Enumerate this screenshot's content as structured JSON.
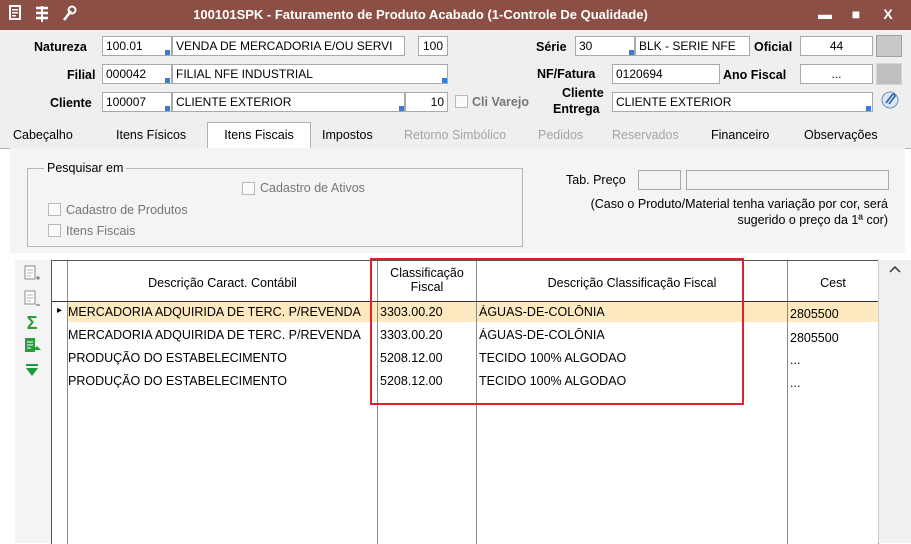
{
  "window": {
    "title": "100101SPK - Faturamento de Produto Acabado (1-Controle De Qualidade)",
    "titlebar_color": "#8c4f45",
    "buttons": {
      "minimize": "▬",
      "maximize": "■",
      "close": "X"
    }
  },
  "form": {
    "natureza": {
      "label": "Natureza",
      "code": "100.01",
      "desc": "VENDA DE MERCADORIA E/OU SERVI",
      "num": "100"
    },
    "filial": {
      "label": "Filial",
      "code": "000042",
      "desc": "FILIAL NFE INDUSTRIAL"
    },
    "cliente": {
      "label": "Cliente",
      "code": "100007",
      "desc": "CLIENTE EXTERIOR",
      "num": "10",
      "varejo_label": "Cli Varejo"
    },
    "serie": {
      "label": "Série",
      "code": "30",
      "desc": "BLK - SERIE NFE"
    },
    "oficial": {
      "label": "Oficial",
      "value": "44"
    },
    "nf_fatura": {
      "label": "NF/Fatura",
      "value": "0120694"
    },
    "ano_fiscal": {
      "label": "Ano Fiscal",
      "value": "..."
    },
    "cliente_entrega": {
      "label_line1": "Cliente",
      "label_line2": "Entrega",
      "value": "CLIENTE EXTERIOR"
    }
  },
  "tabs": [
    {
      "label": "Cabeçalho",
      "state": "normal"
    },
    {
      "label": "Itens Físicos",
      "state": "normal"
    },
    {
      "label": "Itens Fiscais",
      "state": "active"
    },
    {
      "label": "Impostos",
      "state": "normal"
    },
    {
      "label": "Retorno Simbólico",
      "state": "disabled"
    },
    {
      "label": "Pedidos",
      "state": "disabled"
    },
    {
      "label": "Reservados",
      "state": "disabled"
    },
    {
      "label": "Financeiro",
      "state": "normal"
    },
    {
      "label": "Observações",
      "state": "normal"
    }
  ],
  "search": {
    "group_title": "Pesquisar em",
    "cadastro_ativos": "Cadastro de Ativos",
    "cadastro_produtos": "Cadastro de Produtos",
    "itens_fiscais": "Itens Fiscais",
    "tab_preco_label": "Tab. Preço",
    "note_line1": "(Caso o Produto/Material tenha variação por cor, será",
    "note_line2": "sugerido o preço da 1ª cor)"
  },
  "table": {
    "headers": {
      "descricao": "Descrição Caract. Contábil",
      "classificacao_l1": "Classificação",
      "classificacao_l2": "Fiscal",
      "descricao_class": "Descrição Classificação Fiscal",
      "cest": "Cest"
    },
    "rows": [
      {
        "descricao": "MERCADORIA ADQUIRIDA DE TERC. P/REVENDA",
        "classificacao": "3303.00.20",
        "desc_class": "ÁGUAS-DE-COLÔNIA",
        "cest": "2805500"
      },
      {
        "descricao": "MERCADORIA ADQUIRIDA DE TERC. P/REVENDA",
        "classificacao": "3303.00.20",
        "desc_class": "ÁGUAS-DE-COLÔNIA",
        "cest": "2805500"
      },
      {
        "descricao": "PRODUÇÃO DO ESTABELECIMENTO",
        "classificacao": "5208.12.00",
        "desc_class": "TECIDO 100% ALGODAO",
        "cest": "..."
      },
      {
        "descricao": "PRODUÇÃO DO ESTABELECIMENTO",
        "classificacao": "5208.12.00",
        "desc_class": "TECIDO 100% ALGODAO",
        "cest": "..."
      }
    ],
    "selected_row_indicator": "▸",
    "highlight_color": "#e0202a"
  },
  "icons": {
    "menu": "menu-icon",
    "sync": "sync-icon",
    "tools": "wrench-icon",
    "sum": "Σ"
  }
}
